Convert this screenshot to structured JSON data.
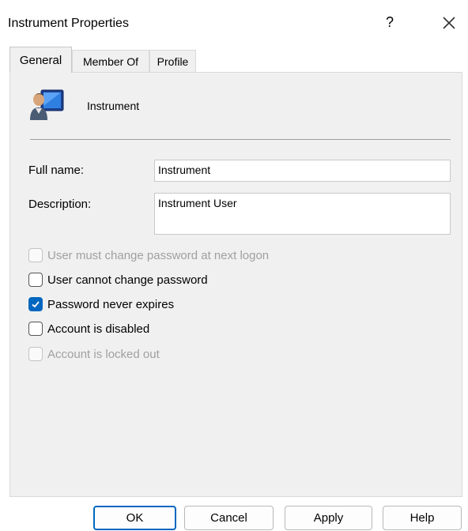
{
  "window": {
    "title": "Instrument Properties",
    "help_label": "?",
    "close_icon": "close-icon"
  },
  "tabs": [
    {
      "label": "General",
      "selected": true
    },
    {
      "label": "Member Of",
      "selected": false
    },
    {
      "label": "Profile",
      "selected": false
    }
  ],
  "user": {
    "icon": "user-monitor-icon",
    "name": "Instrument"
  },
  "form": {
    "full_name_label": "Full name:",
    "full_name_value": "Instrument",
    "description_label": "Description:",
    "description_value": "Instrument User"
  },
  "checkboxes": [
    {
      "label": "User must change password at next logon",
      "checked": false,
      "enabled": false
    },
    {
      "label": "User cannot change password",
      "checked": false,
      "enabled": true
    },
    {
      "label": "Password never expires",
      "checked": true,
      "enabled": true
    },
    {
      "label": "Account is disabled",
      "checked": false,
      "enabled": true
    },
    {
      "label": "Account is locked out",
      "checked": false,
      "enabled": false
    }
  ],
  "buttons": {
    "ok": "OK",
    "cancel": "Cancel",
    "apply": "Apply",
    "help": "Help"
  },
  "colors": {
    "accent": "#0067c0",
    "panel": "#f0f0f0",
    "disabled_text": "#a0a0a0"
  }
}
